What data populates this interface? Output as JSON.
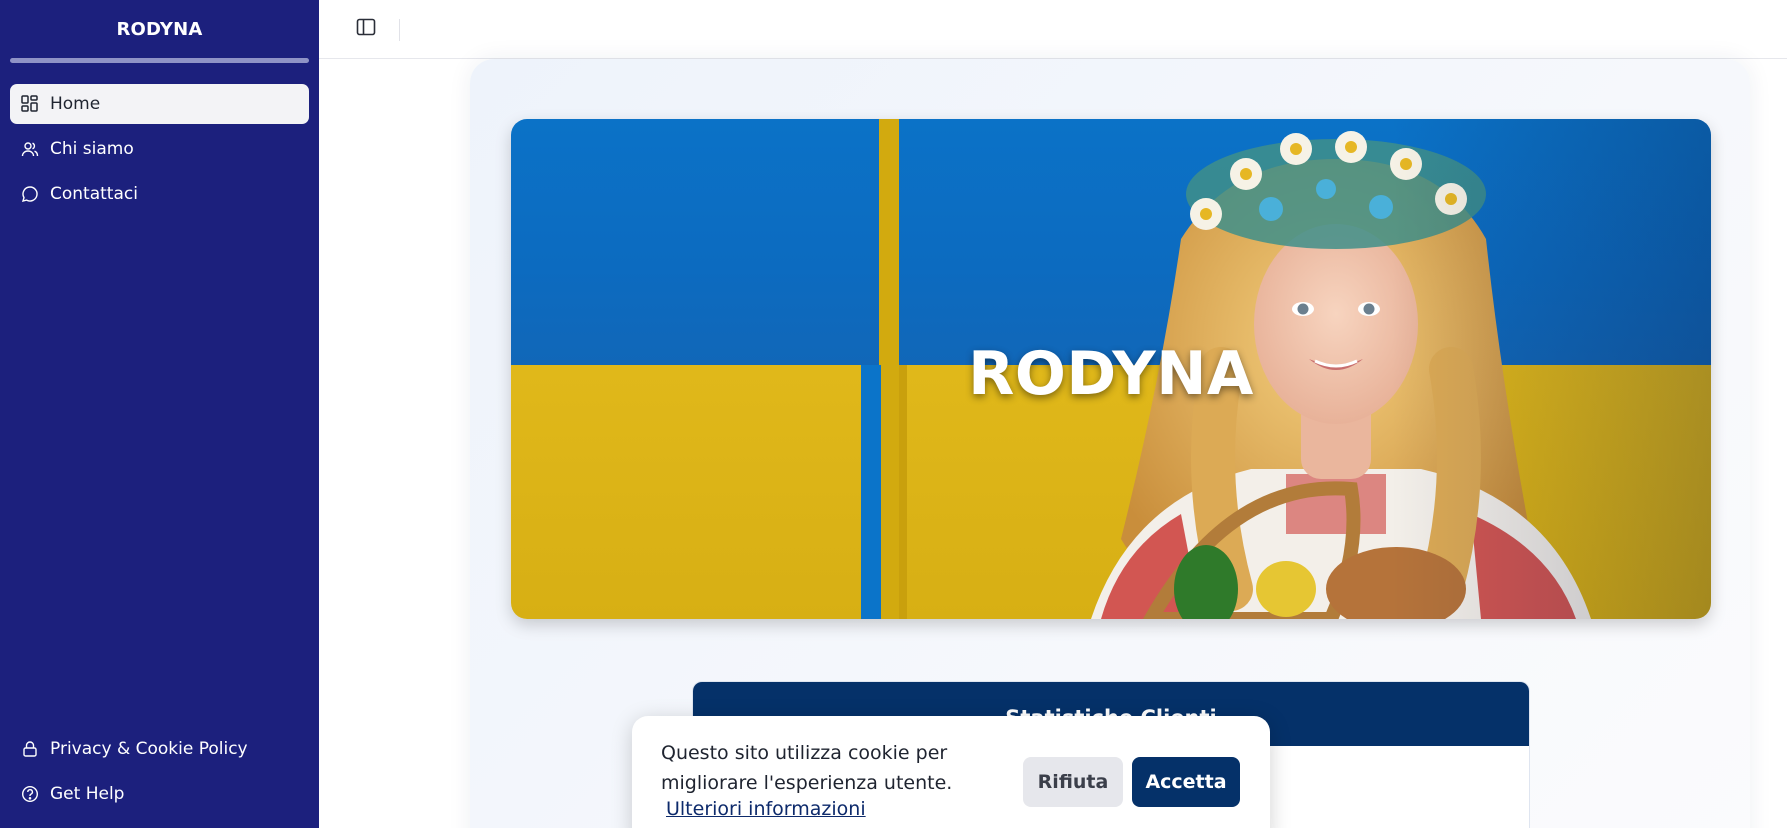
{
  "app": {
    "brand": "RODYNA"
  },
  "sidebar": {
    "items": [
      {
        "label": "Home",
        "icon": "dashboard-icon",
        "active": true
      },
      {
        "label": "Chi siamo",
        "icon": "users-icon",
        "active": false
      },
      {
        "label": "Contattaci",
        "icon": "chat-bubble-icon",
        "active": false
      }
    ],
    "footer_items": [
      {
        "label": "Privacy & Cookie Policy",
        "icon": "lock-icon"
      },
      {
        "label": "Get Help",
        "icon": "help-circle-icon"
      }
    ]
  },
  "topbar": {
    "toggle_icon": "sidebar-toggle-icon"
  },
  "hero": {
    "title": "RODYNA"
  },
  "stats": {
    "title": "Statistiche Clienti"
  },
  "cookie": {
    "text": "Questo sito utilizza cookie per migliorare l'esperienza utente.",
    "link": "Ulteriori informazioni",
    "reject_label": "Rifiuta",
    "accept_label": "Accetta"
  },
  "colors": {
    "sidebar_bg": "#1c207d",
    "primary": "#053169",
    "flag_blue": "#0b72c7",
    "flag_yellow": "#e0b81a"
  }
}
